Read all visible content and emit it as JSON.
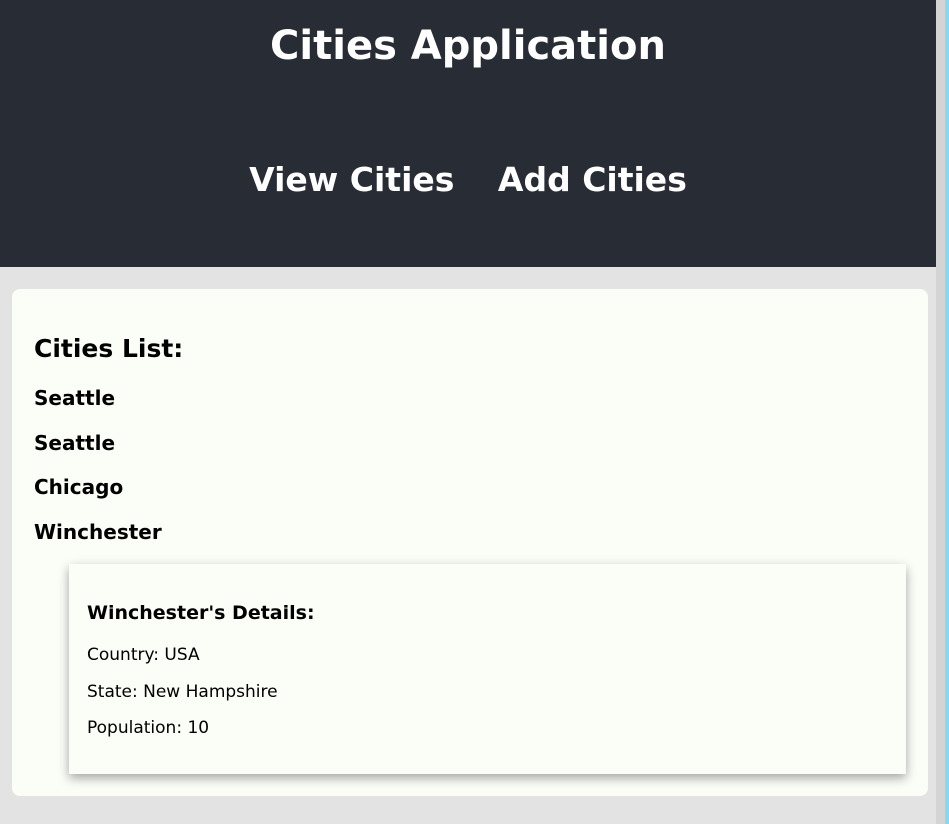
{
  "header": {
    "title": "Cities Application",
    "nav": {
      "view_label": "View Cities",
      "add_label": "Add Cities"
    }
  },
  "cities": {
    "list_title": "Cities List:",
    "items": [
      "Seattle",
      "Seattle",
      "Chicago",
      "Winchester"
    ]
  },
  "details": {
    "title": "Winchester's Details:",
    "country": "Country: USA",
    "state": "State: New Hampshire",
    "population": "Population: 10"
  },
  "colors": {
    "header_bg": "#282c35",
    "page_bg": "#e3e3e3",
    "card_bg": "#fbfdf7",
    "accent": "#61dafb"
  }
}
